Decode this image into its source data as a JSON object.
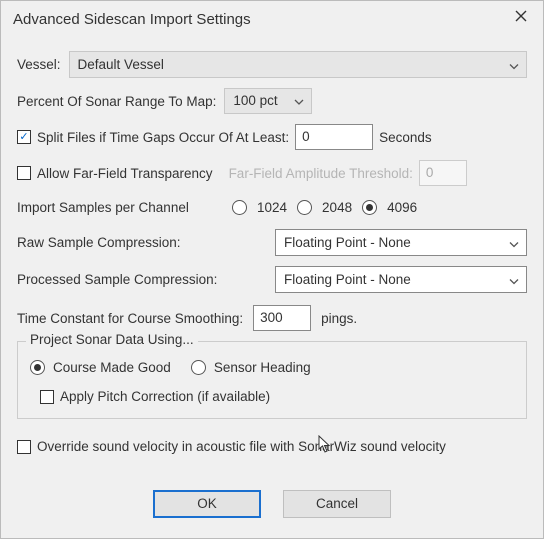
{
  "title": "Advanced Sidescan Import Settings",
  "vessel": {
    "label": "Vessel:",
    "value": "Default Vessel"
  },
  "percent": {
    "label": "Percent Of Sonar Range To Map:",
    "value": "100 pct"
  },
  "splitFiles": {
    "checked": true,
    "label": "Split Files if Time Gaps Occur Of At Least:",
    "value": "0",
    "suffix": "Seconds"
  },
  "farField": {
    "checked": false,
    "label": "Allow Far-Field Transparency",
    "thresholdLabel": "Far-Field Amplitude Threshold:",
    "thresholdValue": "0"
  },
  "samples": {
    "label": "Import Samples per Channel",
    "opt1": "1024",
    "opt2": "2048",
    "opt3": "4096",
    "selected": "4096"
  },
  "rawCompress": {
    "label": "Raw Sample Compression:",
    "value": "Floating Point - None"
  },
  "procCompress": {
    "label": "Processed Sample Compression:",
    "value": "Floating Point - None"
  },
  "timeConst": {
    "label": "Time Constant for Course Smoothing:",
    "value": "300",
    "suffix": "pings."
  },
  "project": {
    "legend": "Project Sonar Data Using...",
    "opt1": "Course Made Good",
    "opt2": "Sensor Heading",
    "selected": "Course Made Good",
    "pitchChecked": false,
    "pitchLabel": "Apply Pitch Correction (if available)"
  },
  "override": {
    "checked": false,
    "label": "Override sound velocity in acoustic file with SonarWiz sound velocity"
  },
  "buttons": {
    "ok": "OK",
    "cancel": "Cancel"
  }
}
